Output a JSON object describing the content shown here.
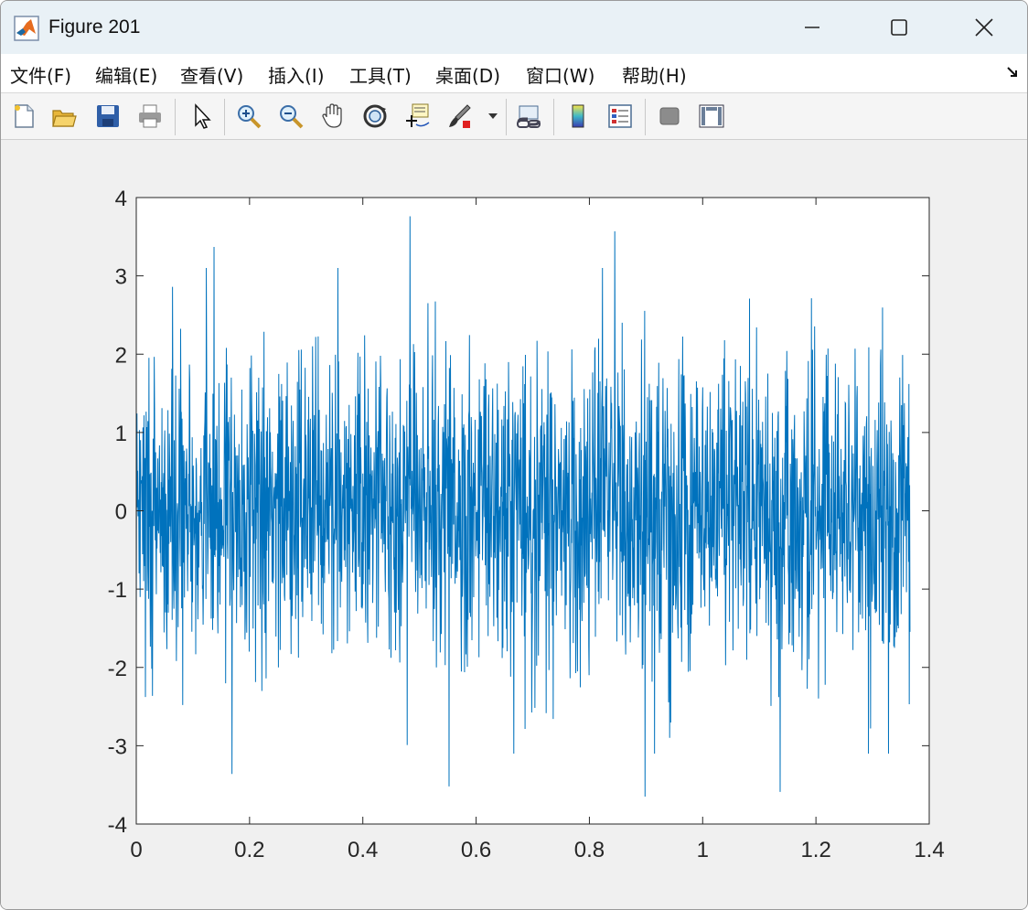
{
  "window": {
    "title": "Figure 201",
    "controls": {
      "minimize": "minimize-icon",
      "maximize": "maximize-icon",
      "close": "close-icon"
    }
  },
  "menu": {
    "items": [
      {
        "label": "文件(F)"
      },
      {
        "label": "编辑(E)"
      },
      {
        "label": "查看(V)"
      },
      {
        "label": "插入(I)"
      },
      {
        "label": "工具(T)"
      },
      {
        "label": "桌面(D)"
      },
      {
        "label": "窗口(W)"
      },
      {
        "label": "帮助(H)"
      }
    ]
  },
  "toolbar": {
    "buttons": [
      "new-figure-icon",
      "open-file-icon",
      "save-icon",
      "print-icon",
      "pointer-icon",
      "zoom-in-icon",
      "zoom-out-icon",
      "pan-hand-icon",
      "rotate-3d-icon",
      "data-cursor-icon",
      "brush-icon",
      "link-plot-icon",
      "colorbar-icon",
      "legend-icon",
      "hide-plot-tools-icon",
      "show-plot-tools-icon"
    ]
  },
  "colors": {
    "line": "#0072bd",
    "axes_bg": "#ffffff",
    "figure_bg": "#f0f0f0"
  },
  "chart_data": {
    "type": "line",
    "title": "",
    "xlabel": "",
    "ylabel": "",
    "xlim": [
      0,
      1.4
    ],
    "ylim": [
      -4,
      4
    ],
    "xticks": [
      "0",
      "0.2",
      "0.4",
      "0.6",
      "0.8",
      "1",
      "1.2",
      "1.4"
    ],
    "yticks": [
      "-4",
      "-3",
      "-2",
      "-1",
      "0",
      "1",
      "2",
      "3",
      "4"
    ],
    "x_end": 1.366,
    "series": [
      {
        "color": "#0072bd",
        "description_stats": {
          "mean": 0,
          "std": 1,
          "min": -3.65,
          "max": 3.76
        },
        "notable_points": [
          {
            "x": 0.137,
            "y": 3.37
          },
          {
            "x": 0.483,
            "y": 3.76
          },
          {
            "x": 0.845,
            "y": 3.57
          },
          {
            "x": 0.169,
            "y": -3.36
          },
          {
            "x": 0.552,
            "y": -3.52
          },
          {
            "x": 0.898,
            "y": -3.65
          },
          {
            "x": 1.137,
            "y": -3.59
          }
        ]
      }
    ],
    "grid": false
  }
}
